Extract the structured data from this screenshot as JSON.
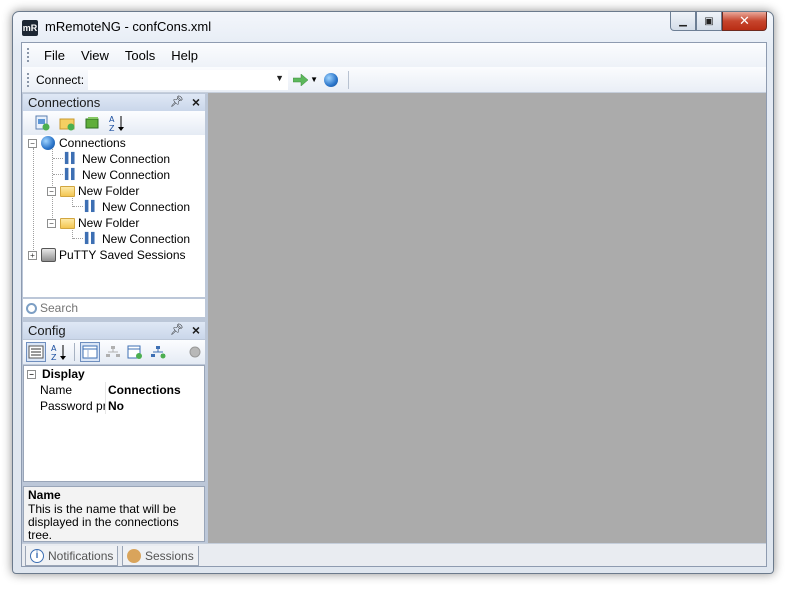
{
  "window": {
    "title": "mRemoteNG - confCons.xml",
    "icon_name": "mremoteng-app-icon",
    "icon_glyph": "mR"
  },
  "menu": {
    "items": [
      "File",
      "View",
      "Tools",
      "Help"
    ]
  },
  "toolbar": {
    "connect_label": "Connect:",
    "connect_value": ""
  },
  "connections_panel": {
    "title": "Connections",
    "tree": {
      "root": "Connections",
      "items": {
        "conn1": "New Connection",
        "conn2": "New Connection",
        "folder1": "New Folder",
        "folder1_conn": "New Connection",
        "folder2": "New Folder",
        "folder2_conn": "New Connection",
        "putty": "PuTTY Saved Sessions"
      }
    },
    "search_placeholder": "Search"
  },
  "config_panel": {
    "title": "Config",
    "category": "Display",
    "properties": [
      {
        "name": "Name",
        "value": "Connections"
      },
      {
        "name": "Password protect",
        "value": "No"
      }
    ],
    "help_title": "Name",
    "help_text": "This is the name that will be displayed in the connections tree."
  },
  "bottom_tabs": [
    "Notifications",
    "Sessions"
  ],
  "colors": {
    "document_background": "#ababab",
    "panel_header": "#cad7ea",
    "close_button": "#c7452d"
  }
}
